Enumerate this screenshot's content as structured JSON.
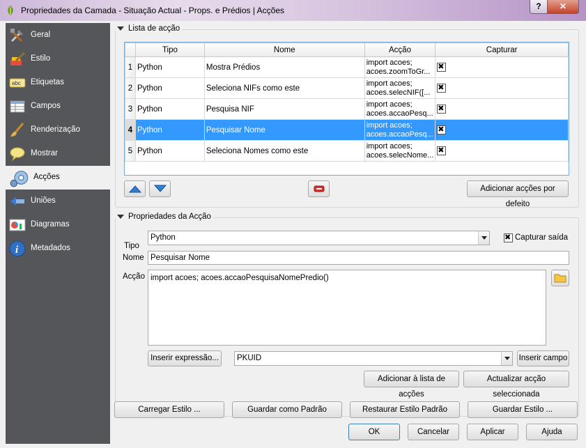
{
  "window": {
    "title": "Propriedades da Camada - Situação Actual - Props. e Prédios | Acções",
    "help": "?",
    "close": "✕"
  },
  "sidebar": {
    "items": [
      {
        "label": "Geral",
        "icon": "tools-icon"
      },
      {
        "label": "Estilo",
        "icon": "style-icon"
      },
      {
        "label": "Etiquetas",
        "icon": "labels-abc-icon"
      },
      {
        "label": "Campos",
        "icon": "fields-table-icon"
      },
      {
        "label": "Renderização",
        "icon": "rendering-brush-icon"
      },
      {
        "label": "Mostrar",
        "icon": "display-balloon-icon"
      },
      {
        "label": "Acções",
        "icon": "actions-gear-icon"
      },
      {
        "label": "Uniões",
        "icon": "joins-icon"
      },
      {
        "label": "Diagramas",
        "icon": "diagrams-icon"
      },
      {
        "label": "Metadados",
        "icon": "info-icon"
      }
    ],
    "active_index": 6
  },
  "actions_list": {
    "title": "Lista de acção",
    "columns": [
      "Tipo",
      "Nome",
      "Acção",
      "Capturar"
    ],
    "rows": [
      {
        "num": "1",
        "tipo": "Python",
        "nome": "Mostra Prédios",
        "accao": "import acoes; acoes.zoomToGr...",
        "capturar": true
      },
      {
        "num": "2",
        "tipo": "Python",
        "nome": "Seleciona NIFs como este",
        "accao": "import acoes; acoes.selecNIF([...",
        "capturar": true
      },
      {
        "num": "3",
        "tipo": "Python",
        "nome": "Pesquisa NIF",
        "accao": "import acoes; acoes.accaoPesq...",
        "capturar": true
      },
      {
        "num": "4",
        "tipo": "Python",
        "nome": "Pesquisar Nome",
        "accao": "import acoes; acoes.accaoPesq...",
        "capturar": true
      },
      {
        "num": "5",
        "tipo": "Python",
        "nome": "Seleciona Nomes como este",
        "accao": "import acoes; acoes.selecNome...",
        "capturar": true
      }
    ],
    "selected_row": 3,
    "add_defaults": "Adicionar acções por defeito"
  },
  "action_props": {
    "title": "Propriedades da Acção",
    "tipo_label": "Tipo",
    "tipo_value": "Python",
    "capture_label": "Capturar saída",
    "capture_checked": true,
    "nome_label": "Nome",
    "nome_value": "Pesquisar Nome",
    "accao_label": "Acção",
    "accao_value": "import acoes; acoes.accaoPesquisaNomePredio()",
    "insert_expression": "Inserir expressão...",
    "field_value": "PKUID",
    "insert_field": "Inserir campo",
    "add_to_list": "Adicionar à lista de acções",
    "update_selected": "Actualizar acção seleccionada"
  },
  "style_buttons": {
    "load": "Carregar Estilo ...",
    "save_default": "Guardar como Padrão",
    "restore": "Restaurar Estilo Padrão",
    "save": "Guardar Estilo ..."
  },
  "dialog_buttons": {
    "ok": "OK",
    "cancel": "Cancelar",
    "apply": "Aplicar",
    "help": "Ajuda"
  },
  "colors": {
    "selection": "#3399ff",
    "sidebar": "#555659"
  }
}
